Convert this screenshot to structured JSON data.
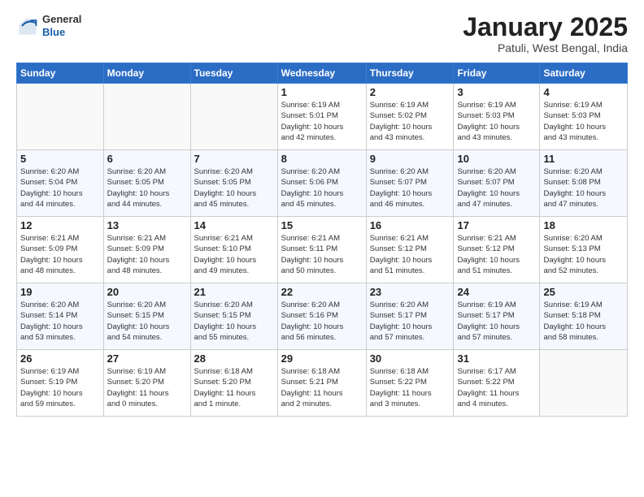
{
  "header": {
    "logo": {
      "general": "General",
      "blue": "Blue"
    },
    "title": "January 2025",
    "subtitle": "Patuli, West Bengal, India"
  },
  "weekdays": [
    "Sunday",
    "Monday",
    "Tuesday",
    "Wednesday",
    "Thursday",
    "Friday",
    "Saturday"
  ],
  "weeks": [
    [
      {
        "day": "",
        "info": ""
      },
      {
        "day": "",
        "info": ""
      },
      {
        "day": "",
        "info": ""
      },
      {
        "day": "1",
        "info": "Sunrise: 6:19 AM\nSunset: 5:01 PM\nDaylight: 10 hours\nand 42 minutes."
      },
      {
        "day": "2",
        "info": "Sunrise: 6:19 AM\nSunset: 5:02 PM\nDaylight: 10 hours\nand 43 minutes."
      },
      {
        "day": "3",
        "info": "Sunrise: 6:19 AM\nSunset: 5:03 PM\nDaylight: 10 hours\nand 43 minutes."
      },
      {
        "day": "4",
        "info": "Sunrise: 6:19 AM\nSunset: 5:03 PM\nDaylight: 10 hours\nand 43 minutes."
      }
    ],
    [
      {
        "day": "5",
        "info": "Sunrise: 6:20 AM\nSunset: 5:04 PM\nDaylight: 10 hours\nand 44 minutes."
      },
      {
        "day": "6",
        "info": "Sunrise: 6:20 AM\nSunset: 5:05 PM\nDaylight: 10 hours\nand 44 minutes."
      },
      {
        "day": "7",
        "info": "Sunrise: 6:20 AM\nSunset: 5:05 PM\nDaylight: 10 hours\nand 45 minutes."
      },
      {
        "day": "8",
        "info": "Sunrise: 6:20 AM\nSunset: 5:06 PM\nDaylight: 10 hours\nand 45 minutes."
      },
      {
        "day": "9",
        "info": "Sunrise: 6:20 AM\nSunset: 5:07 PM\nDaylight: 10 hours\nand 46 minutes."
      },
      {
        "day": "10",
        "info": "Sunrise: 6:20 AM\nSunset: 5:07 PM\nDaylight: 10 hours\nand 47 minutes."
      },
      {
        "day": "11",
        "info": "Sunrise: 6:20 AM\nSunset: 5:08 PM\nDaylight: 10 hours\nand 47 minutes."
      }
    ],
    [
      {
        "day": "12",
        "info": "Sunrise: 6:21 AM\nSunset: 5:09 PM\nDaylight: 10 hours\nand 48 minutes."
      },
      {
        "day": "13",
        "info": "Sunrise: 6:21 AM\nSunset: 5:09 PM\nDaylight: 10 hours\nand 48 minutes."
      },
      {
        "day": "14",
        "info": "Sunrise: 6:21 AM\nSunset: 5:10 PM\nDaylight: 10 hours\nand 49 minutes."
      },
      {
        "day": "15",
        "info": "Sunrise: 6:21 AM\nSunset: 5:11 PM\nDaylight: 10 hours\nand 50 minutes."
      },
      {
        "day": "16",
        "info": "Sunrise: 6:21 AM\nSunset: 5:12 PM\nDaylight: 10 hours\nand 51 minutes."
      },
      {
        "day": "17",
        "info": "Sunrise: 6:21 AM\nSunset: 5:12 PM\nDaylight: 10 hours\nand 51 minutes."
      },
      {
        "day": "18",
        "info": "Sunrise: 6:20 AM\nSunset: 5:13 PM\nDaylight: 10 hours\nand 52 minutes."
      }
    ],
    [
      {
        "day": "19",
        "info": "Sunrise: 6:20 AM\nSunset: 5:14 PM\nDaylight: 10 hours\nand 53 minutes."
      },
      {
        "day": "20",
        "info": "Sunrise: 6:20 AM\nSunset: 5:15 PM\nDaylight: 10 hours\nand 54 minutes."
      },
      {
        "day": "21",
        "info": "Sunrise: 6:20 AM\nSunset: 5:15 PM\nDaylight: 10 hours\nand 55 minutes."
      },
      {
        "day": "22",
        "info": "Sunrise: 6:20 AM\nSunset: 5:16 PM\nDaylight: 10 hours\nand 56 minutes."
      },
      {
        "day": "23",
        "info": "Sunrise: 6:20 AM\nSunset: 5:17 PM\nDaylight: 10 hours\nand 57 minutes."
      },
      {
        "day": "24",
        "info": "Sunrise: 6:19 AM\nSunset: 5:17 PM\nDaylight: 10 hours\nand 57 minutes."
      },
      {
        "day": "25",
        "info": "Sunrise: 6:19 AM\nSunset: 5:18 PM\nDaylight: 10 hours\nand 58 minutes."
      }
    ],
    [
      {
        "day": "26",
        "info": "Sunrise: 6:19 AM\nSunset: 5:19 PM\nDaylight: 10 hours\nand 59 minutes."
      },
      {
        "day": "27",
        "info": "Sunrise: 6:19 AM\nSunset: 5:20 PM\nDaylight: 11 hours\nand 0 minutes."
      },
      {
        "day": "28",
        "info": "Sunrise: 6:18 AM\nSunset: 5:20 PM\nDaylight: 11 hours\nand 1 minute."
      },
      {
        "day": "29",
        "info": "Sunrise: 6:18 AM\nSunset: 5:21 PM\nDaylight: 11 hours\nand 2 minutes."
      },
      {
        "day": "30",
        "info": "Sunrise: 6:18 AM\nSunset: 5:22 PM\nDaylight: 11 hours\nand 3 minutes."
      },
      {
        "day": "31",
        "info": "Sunrise: 6:17 AM\nSunset: 5:22 PM\nDaylight: 11 hours\nand 4 minutes."
      },
      {
        "day": "",
        "info": ""
      }
    ]
  ]
}
